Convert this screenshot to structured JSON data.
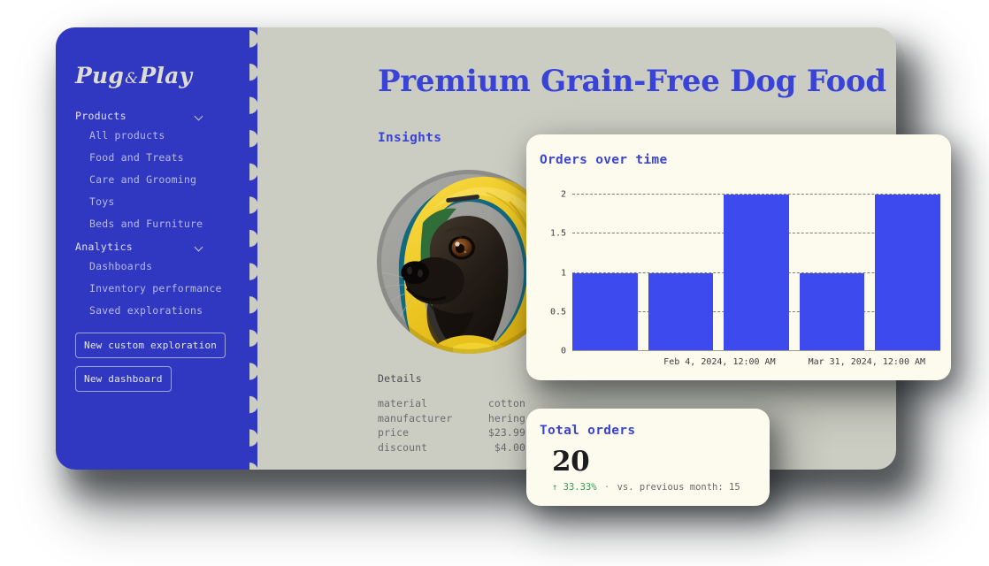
{
  "theme": {
    "sidebar_bg": "#3037C0",
    "content_bg": "#CCCDC2",
    "card_bg": "#FDFBEE",
    "accent_blue": "#3A43D8",
    "bar_blue": "#3D4BEE",
    "positive_green": "#2F9E4F"
  },
  "sidebar": {
    "logo": {
      "first": "Pug",
      "amp": "&",
      "second": "Play"
    },
    "sections": [
      {
        "label": "Products",
        "chevron_icon": "chevron-down-icon",
        "items": [
          "All products",
          "Food and Treats",
          "Care and Grooming",
          "Toys",
          "Beds and Furniture"
        ]
      },
      {
        "label": "Analytics",
        "chevron_icon": "chevron-down-icon",
        "items": [
          "Dashboards",
          "Inventory performance",
          "Saved explorations"
        ]
      }
    ],
    "buttons": [
      "New custom exploration",
      "New dashboard"
    ]
  },
  "main": {
    "title": "Premium Grain-Free Dog Food",
    "insights_label": "Insights",
    "photo_alt": "pug-in-yellow-raincoat-photo",
    "details": {
      "title": "Details",
      "rows": [
        {
          "key": "material",
          "value": "cotton"
        },
        {
          "key": "manufacturer",
          "value": "hering"
        },
        {
          "key": "price",
          "value": "$23.99"
        },
        {
          "key": "discount",
          "value": "$4.00"
        }
      ]
    }
  },
  "orders_card": {
    "title": "Total orders",
    "value": "20",
    "delta_arrow": "↑",
    "delta_percent": "33.33%",
    "separator": "·",
    "comparison": "vs. previous month: 15"
  },
  "chart_data": {
    "type": "bar",
    "title": "Orders over time",
    "xlabel": "",
    "ylabel": "",
    "categories": [
      "Feb 4, 2024, 12:00 AM",
      "",
      "",
      "Mar 31, 2024, 12:00 AM",
      ""
    ],
    "values": [
      1,
      1,
      2,
      1,
      2
    ],
    "ylim": [
      0,
      2
    ],
    "yticks": [
      0,
      0.5,
      1,
      1.5,
      2
    ],
    "ytick_labels": [
      "0",
      "0.5",
      "1",
      "1.5",
      "2"
    ],
    "xtick_labels": [
      "Feb 4, 2024, 12:00 AM",
      "Mar 31, 2024, 12:00 AM"
    ],
    "xtick_positions": [
      1.5,
      3.5
    ],
    "grid": true,
    "grid_style": "dashed",
    "legend": false,
    "bar_color": "#3D4BEE"
  }
}
